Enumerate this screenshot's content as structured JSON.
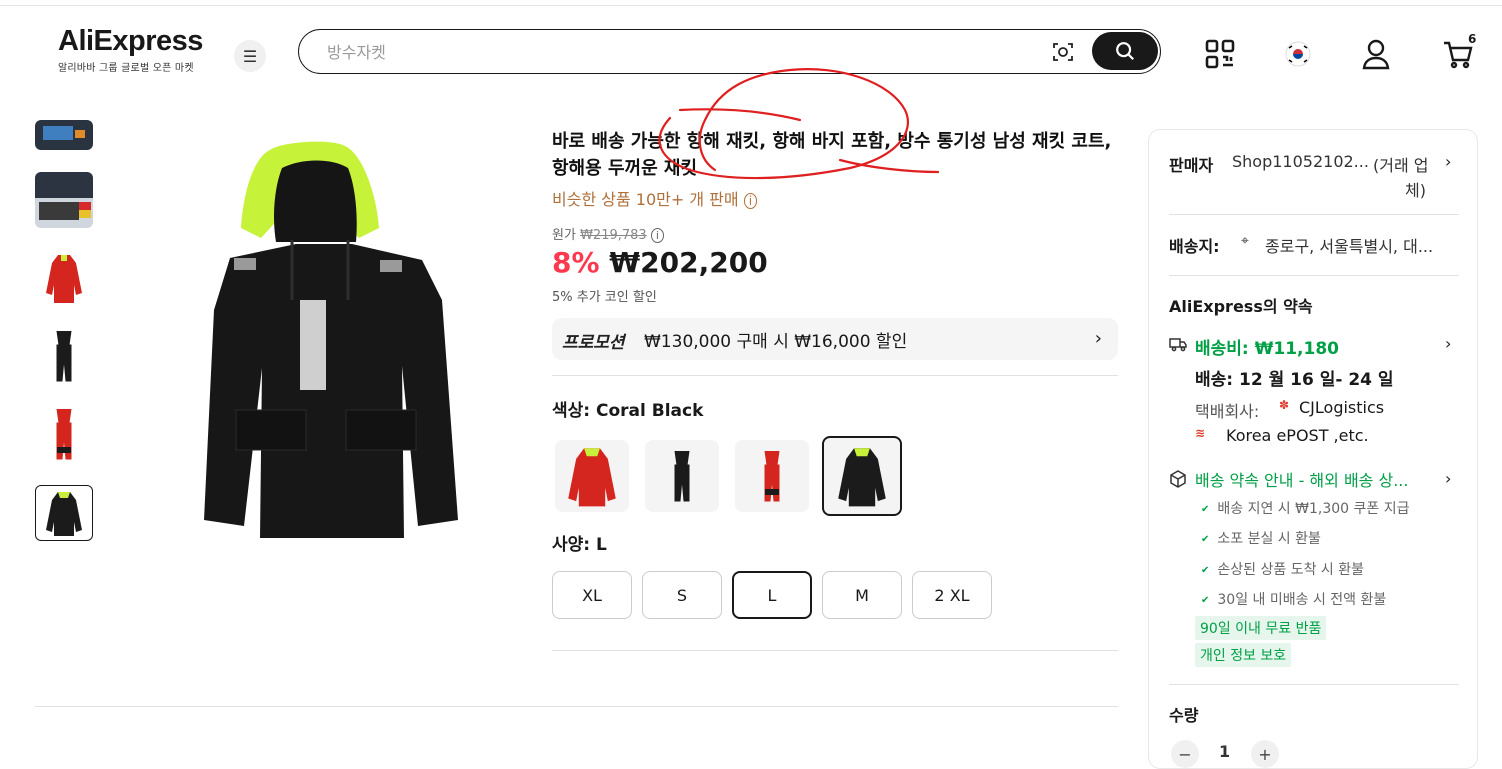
{
  "header": {
    "logo_text": "AliExpress",
    "logo_sub": "알리바바 그룹 글로벌 오픈 마켓",
    "search_placeholder": "방수자켓",
    "cart_count": "6",
    "icons": [
      "menu-icon",
      "camera-search-icon",
      "search-icon",
      "qr-code-icon",
      "korea-flag-icon",
      "account-icon",
      "cart-icon"
    ]
  },
  "product": {
    "title": "바로 배송 가능한 항해 재킷, 항해 바지 포함, 방수 통기성 남성 재킷 코트, 항해용 두꺼운 재킷",
    "similar": "비슷한 상품 10만+ 개 판매",
    "original_label": "원가",
    "original_price": "₩219,783",
    "discount": "8%",
    "price": "₩202,200",
    "coin_discount": "5% 추가 코인 할인",
    "promo_tag": "프로모션",
    "promo_text": "₩130,000 구매 시 ₩16,000 할인",
    "color_label": "색상:",
    "color_value": "Coral Black",
    "size_label": "사양:",
    "size_value": "L",
    "sizes": [
      "XL",
      "S",
      "L",
      "M",
      "2 XL"
    ],
    "selected_size": "L"
  },
  "panel": {
    "seller_label": "판매자",
    "seller_name": "Shop11052102...",
    "seller_note": "(거래 업",
    "seller_note2": "체)",
    "ship_to_label": "배송지:",
    "ship_to": "종로구, 서울특별시, 대...",
    "promise_title": "AliExpress의 약속",
    "shipping_fee": "배송비: ₩11,180",
    "delivery": "배송: 12 월 16 일- 24 일",
    "courier_label": "택배회사:",
    "courier1": "CJLogistics",
    "courier2": "Korea ePOST ,etc.",
    "guide": "배송 약속 안내 - 해외 배송 상...",
    "checks": [
      "배송 지연 시 ₩1,300 쿠폰 지급",
      "소포 분실 시 환불",
      "손상된 상품 도착 시 환불",
      "30일 내 미배송 시 전액 환불"
    ],
    "pills": [
      "90일 이내 무료 반품",
      "개인 정보 보호"
    ],
    "qty_label": "수량",
    "qty_minus": "−",
    "qty_value": "1",
    "qty_plus": "+"
  },
  "colors": {
    "accent_red": "#fd384f",
    "green": "#00a046",
    "similar": "#b0703b"
  }
}
